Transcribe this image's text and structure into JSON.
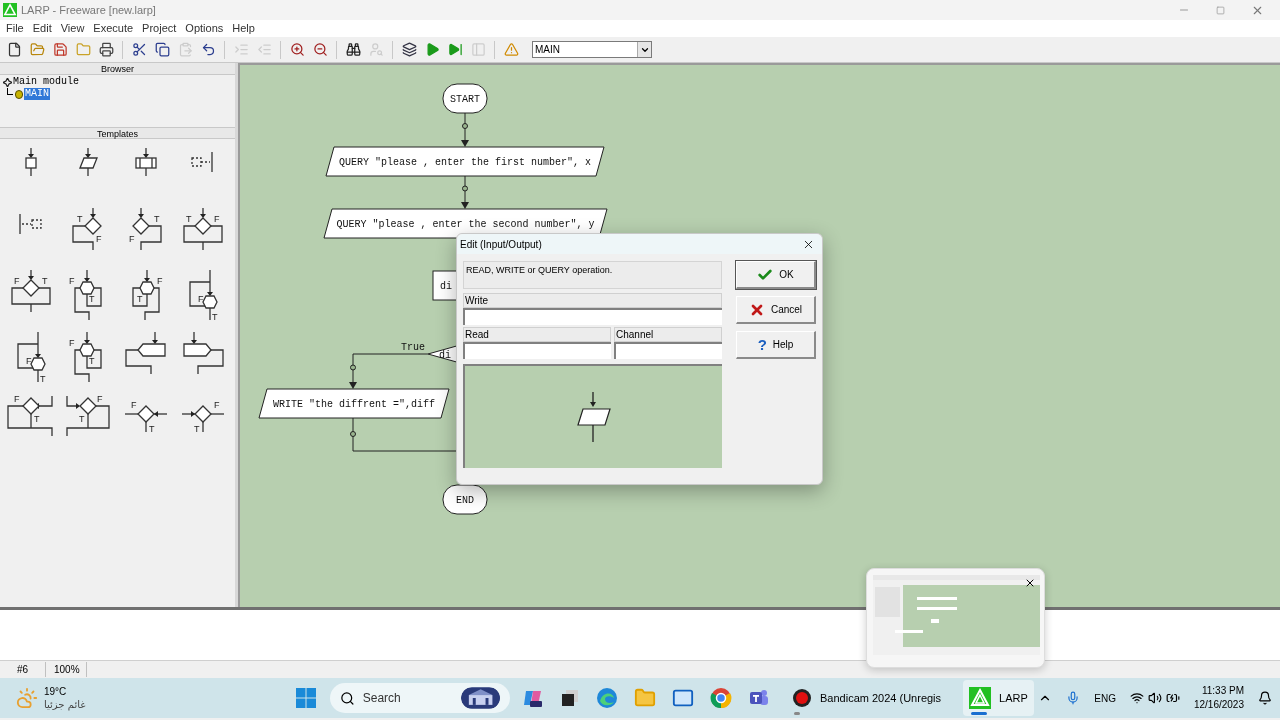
{
  "window": {
    "title": "LARP - Freeware [new.larp]"
  },
  "menu": [
    "File",
    "Edit",
    "View",
    "Execute",
    "Project",
    "Options",
    "Help"
  ],
  "toolbar": [
    {
      "disabled": false
    },
    {
      "disabled": false
    },
    {
      "disabled": false
    },
    {
      "disabled": false
    },
    {
      "disabled": false
    },
    {
      "disabled": false
    },
    {
      "disabled": false
    },
    {
      "disabled": true
    },
    {
      "disabled": false
    },
    {
      "disabled": true
    },
    {
      "disabled": true
    },
    {
      "disabled": false
    },
    {
      "disabled": false
    },
    {
      "disabled": false
    },
    {
      "disabled": true
    },
    {
      "disabled": false
    },
    {
      "disabled": false
    },
    {
      "disabled": false
    },
    {
      "disabled": true
    },
    {
      "disabled": false
    }
  ],
  "module_select": {
    "value": "MAIN"
  },
  "browser": {
    "title": "Browser",
    "tree": [
      {
        "label": "Main module",
        "children": [
          {
            "label": "MAIN",
            "selected": true
          }
        ]
      }
    ]
  },
  "templates": {
    "title": "Templates",
    "items": [
      {
        "kind": "process"
      },
      {
        "kind": "io"
      },
      {
        "kind": "call"
      },
      {
        "kind": "comment-right"
      },
      {
        "kind": "comment-left"
      },
      {
        "kind": "decision-left",
        "labels": [
          "T",
          "F"
        ]
      },
      {
        "kind": "decision-right",
        "labels": [
          "F",
          "T"
        ]
      },
      {
        "kind": "decision-both",
        "labels": [
          "T",
          "F"
        ]
      },
      {
        "kind": "decision-both",
        "labels": [
          "F",
          "T"
        ]
      },
      {
        "kind": "loop-left",
        "labels": [
          "F",
          "T"
        ]
      },
      {
        "kind": "loop-right",
        "labels": [
          "F",
          "T"
        ]
      },
      {
        "kind": "loop-side",
        "labels": [
          "F",
          "T"
        ]
      },
      {
        "kind": "loop-side",
        "labels": [
          "F",
          "T"
        ]
      },
      {
        "kind": "loop-left",
        "labels": [
          "F",
          "T"
        ]
      },
      {
        "kind": "block-left"
      },
      {
        "kind": "block-right"
      },
      {
        "kind": "select-left",
        "labels": [
          "F",
          "T"
        ]
      },
      {
        "kind": "select-right",
        "labels": [
          "F",
          "T"
        ]
      },
      {
        "kind": "branch-left",
        "labels": [
          "F",
          "T"
        ]
      },
      {
        "kind": "branch-right",
        "labels": [
          "F",
          "T"
        ]
      }
    ]
  },
  "flowchart": {
    "nodes": [
      {
        "kind": "terminal",
        "text": "START"
      },
      {
        "kind": "io",
        "text": "QUERY \"please , enter the first number\", x"
      },
      {
        "kind": "io",
        "text": "QUERY \"please , enter the second number\", y"
      },
      {
        "kind": "process",
        "text": "di"
      },
      {
        "kind": "decision",
        "text": "di",
        "branch_label": "True"
      },
      {
        "kind": "io",
        "text": "WRITE \"the diffrent =\",diff"
      },
      {
        "kind": "terminal",
        "text": "END"
      }
    ]
  },
  "dialog": {
    "title": "Edit (Input/Output)",
    "description": "READ, WRITE or QUERY operation.",
    "fields": [
      {
        "label": "Write"
      },
      {
        "label": "Read"
      },
      {
        "label": "Channel"
      }
    ],
    "buttons": [
      {
        "kind": "ok",
        "label": "OK"
      },
      {
        "kind": "cancel",
        "label": "Cancel"
      },
      {
        "kind": "help",
        "label": "Help",
        "icon": "?"
      }
    ]
  },
  "status_bar": [
    "#6",
    "100%"
  ],
  "thumbnail": {
    "kind": "picture"
  },
  "taskbar": {
    "weather": {
      "temperature": "19°C",
      "condition": "غائم جزئيا"
    },
    "search": {
      "placeholder": "Search"
    },
    "apps": [
      {
        "kind": "copilot"
      },
      {
        "kind": "taskview"
      },
      {
        "kind": "edge"
      },
      {
        "kind": "explorer"
      },
      {
        "kind": "mail"
      },
      {
        "kind": "chrome"
      },
      {
        "kind": "teams"
      },
      {
        "kind": "bandicam",
        "label": "Bandicam 2024 (Unregis",
        "active": false
      },
      {
        "kind": "larp",
        "label": "LARP",
        "active": true
      }
    ],
    "tray": {
      "language": "ENG",
      "time": "11:33 PM",
      "date": "12/16/2023"
    }
  }
}
